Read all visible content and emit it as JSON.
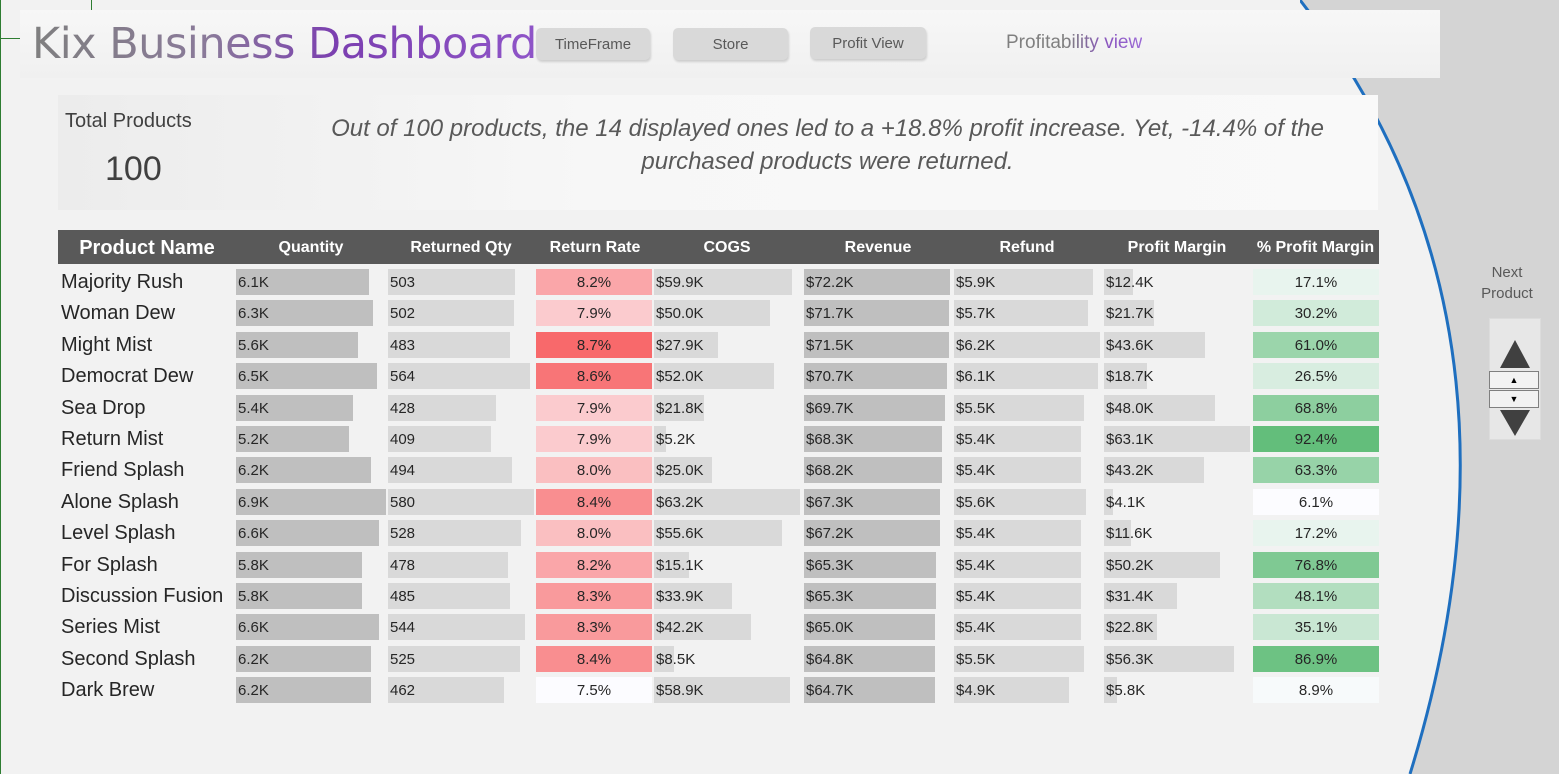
{
  "header": {
    "title": "Kix Business Dashboard",
    "buttons": [
      "TimeFrame",
      "Store",
      "Profit View"
    ],
    "view_label": "Profitability view"
  },
  "kpi": {
    "label": "Total Products",
    "value": "100",
    "insight": "Out of 100 products, the 14 displayed ones led to a +18.8% profit increase. Yet, -14.4% of the purchased products were returned."
  },
  "table": {
    "columns": [
      "Product Name",
      "Quantity",
      "Returned Qty",
      "Return Rate",
      "COGS",
      "Revenue",
      "Refund",
      "Profit Margin",
      "% Profit Margin"
    ],
    "rows": [
      {
        "name": "Majority Rush",
        "qty": "6.1K",
        "ret": "503",
        "rate": "8.2%",
        "cogs": "$59.9K",
        "rev": "$72.2K",
        "refund": "$5.9K",
        "pm": "$12.4K",
        "pct": "17.1%"
      },
      {
        "name": "Woman Dew",
        "qty": "6.3K",
        "ret": "502",
        "rate": "7.9%",
        "cogs": "$50.0K",
        "rev": "$71.7K",
        "refund": "$5.7K",
        "pm": "$21.7K",
        "pct": "30.2%"
      },
      {
        "name": "Might Mist",
        "qty": "5.6K",
        "ret": "483",
        "rate": "8.7%",
        "cogs": "$27.9K",
        "rev": "$71.5K",
        "refund": "$6.2K",
        "pm": "$43.6K",
        "pct": "61.0%"
      },
      {
        "name": "Democrat Dew",
        "qty": "6.5K",
        "ret": "564",
        "rate": "8.6%",
        "cogs": "$52.0K",
        "rev": "$70.7K",
        "refund": "$6.1K",
        "pm": "$18.7K",
        "pct": "26.5%"
      },
      {
        "name": "Sea Drop",
        "qty": "5.4K",
        "ret": "428",
        "rate": "7.9%",
        "cogs": "$21.8K",
        "rev": "$69.7K",
        "refund": "$5.5K",
        "pm": "$48.0K",
        "pct": "68.8%"
      },
      {
        "name": "Return Mist",
        "qty": "5.2K",
        "ret": "409",
        "rate": "7.9%",
        "cogs": "$5.2K",
        "rev": "$68.3K",
        "refund": "$5.4K",
        "pm": "$63.1K",
        "pct": "92.4%"
      },
      {
        "name": "Friend Splash",
        "qty": "6.2K",
        "ret": "494",
        "rate": "8.0%",
        "cogs": "$25.0K",
        "rev": "$68.2K",
        "refund": "$5.4K",
        "pm": "$43.2K",
        "pct": "63.3%"
      },
      {
        "name": "Alone Splash",
        "qty": "6.9K",
        "ret": "580",
        "rate": "8.4%",
        "cogs": "$63.2K",
        "rev": "$67.3K",
        "refund": "$5.6K",
        "pm": "$4.1K",
        "pct": "6.1%"
      },
      {
        "name": "Level Splash",
        "qty": "6.6K",
        "ret": "528",
        "rate": "8.0%",
        "cogs": "$55.6K",
        "rev": "$67.2K",
        "refund": "$5.4K",
        "pm": "$11.6K",
        "pct": "17.2%"
      },
      {
        "name": "For Splash",
        "qty": "5.8K",
        "ret": "478",
        "rate": "8.2%",
        "cogs": "$15.1K",
        "rev": "$65.3K",
        "refund": "$5.4K",
        "pm": "$50.2K",
        "pct": "76.8%"
      },
      {
        "name": "Discussion Fusion",
        "qty": "5.8K",
        "ret": "485",
        "rate": "8.3%",
        "cogs": "$33.9K",
        "rev": "$65.3K",
        "refund": "$5.4K",
        "pm": "$31.4K",
        "pct": "48.1%"
      },
      {
        "name": "Series Mist",
        "qty": "6.6K",
        "ret": "544",
        "rate": "8.3%",
        "cogs": "$42.2K",
        "rev": "$65.0K",
        "refund": "$5.4K",
        "pm": "$22.8K",
        "pct": "35.1%"
      },
      {
        "name": "Second Splash",
        "qty": "6.2K",
        "ret": "525",
        "rate": "8.4%",
        "cogs": "$8.5K",
        "rev": "$64.8K",
        "refund": "$5.5K",
        "pm": "$56.3K",
        "pct": "86.9%"
      },
      {
        "name": "Dark Brew",
        "qty": "6.2K",
        "ret": "462",
        "rate": "7.5%",
        "cogs": "$58.9K",
        "rev": "$64.7K",
        "refund": "$4.9K",
        "pm": "$5.8K",
        "pct": "8.9%"
      }
    ]
  },
  "side": {
    "next_label_1": "Next",
    "next_label_2": "Product"
  },
  "colors": {
    "header_bg": "#595959",
    "bar_dark": "#bfbfbf",
    "bar_light": "#d9d9d9",
    "rate_high": "#f8696b",
    "rate_low": "#fcfcff",
    "pct_high": "#63be7b",
    "pct_low": "#fcfcff",
    "arc_blue": "#1f6fbf"
  }
}
